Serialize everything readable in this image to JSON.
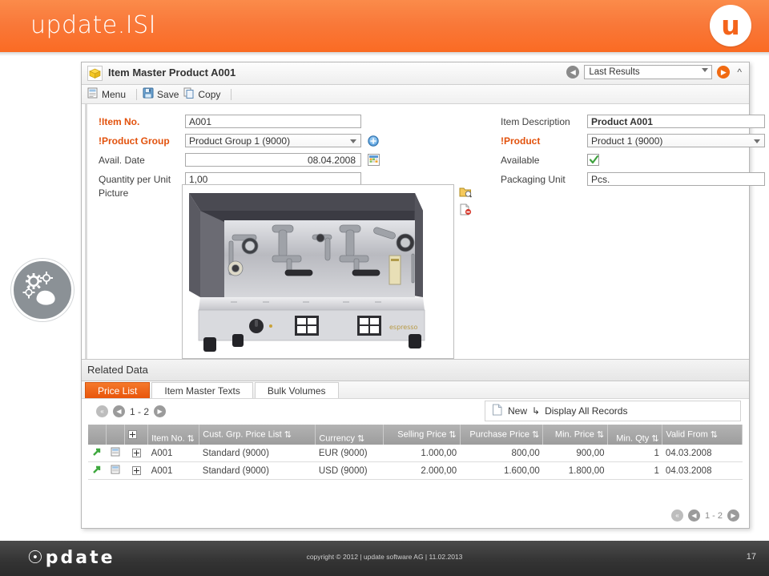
{
  "banner": {
    "title": "update.ISI",
    "logo_letter": "u",
    "logo_icon": "u-circle-logo"
  },
  "decor": {
    "gear_badge_icon": "gears-hand-icon"
  },
  "window": {
    "icon": "yellow-box-icon",
    "title": "Item Master Product A001",
    "results_select": "Last Results",
    "back_icon": "back-arrow-icon",
    "forward_icon": "forward-arrow-icon",
    "collapse_icon": "chevron-up-icon"
  },
  "toolbar": {
    "items": [
      {
        "label": "Menu",
        "icon": "menu-icon"
      },
      {
        "label": "Save",
        "icon": "floppy-disk-icon"
      },
      {
        "label": "Copy",
        "icon": "copy-pages-icon"
      }
    ]
  },
  "form": {
    "left": [
      {
        "label": "Item No.",
        "required": true,
        "type": "input",
        "value": "A001"
      },
      {
        "label": "Product Group",
        "required": true,
        "type": "select",
        "value": "Product Group 1 (9000)",
        "adjunct": "add-circle-icon"
      },
      {
        "label": "Avail. Date",
        "required": false,
        "type": "input-right",
        "value": "08.04.2008",
        "adjunct": "calendar-icon"
      },
      {
        "label": "Quantity per Unit",
        "required": false,
        "type": "input",
        "value": "1,00"
      }
    ],
    "right": [
      {
        "label": "Item Description",
        "required": false,
        "type": "input-bold",
        "value": "Product A001"
      },
      {
        "label": "Product",
        "required": true,
        "type": "select",
        "value": "Product 1 (9000)",
        "adjunct": "download-circle-icon"
      },
      {
        "label": "Available",
        "required": false,
        "type": "checkbox",
        "value": "checked"
      },
      {
        "label": "Packaging Unit",
        "required": false,
        "type": "input",
        "value": "Pcs."
      }
    ],
    "picture_label": "Picture",
    "picture_alt": "espresso-machine-photo",
    "picture_tools": [
      {
        "icon": "folder-search-icon"
      },
      {
        "icon": "document-delete-icon"
      }
    ]
  },
  "related": {
    "section_title": "Related Data",
    "tabs": [
      {
        "label": "Price List",
        "active": true
      },
      {
        "label": "Item Master Texts",
        "active": false
      },
      {
        "label": "Bulk Volumes",
        "active": false
      }
    ],
    "pager_top": {
      "first_icon": "first-page-icon",
      "prev_icon": "prev-page-icon",
      "range": "1 - 2",
      "next_icon": "next-page-icon"
    },
    "actions": {
      "new_label": "New",
      "new_icon": "new-document-icon",
      "display_all_label": "Display All Records",
      "display_all_icon": "arrow-branch-icon"
    },
    "grid": {
      "columns": [
        {
          "label": "",
          "key": "expand-all",
          "align": "center"
        },
        {
          "label": "Item No.",
          "key": "item_no",
          "align": "left"
        },
        {
          "label": "Cust. Grp. Price List",
          "key": "price_list",
          "align": "left"
        },
        {
          "label": "Currency",
          "key": "currency",
          "align": "left"
        },
        {
          "label": "Selling Price",
          "key": "selling_price",
          "align": "right"
        },
        {
          "label": "Purchase Price",
          "key": "purchase_price",
          "align": "right"
        },
        {
          "label": "Min. Price",
          "key": "min_price",
          "align": "right"
        },
        {
          "label": "Min. Qty",
          "key": "min_qty",
          "align": "right"
        },
        {
          "label": "Valid From",
          "key": "valid_from",
          "align": "left"
        }
      ],
      "rows": [
        {
          "item_no": "A001",
          "price_list": "Standard (9000)",
          "currency": "EUR (9000)",
          "selling_price": "1.000,00",
          "purchase_price": "800,00",
          "min_price": "900,00",
          "min_qty": "1",
          "valid_from": "04.03.2008"
        },
        {
          "item_no": "A001",
          "price_list": "Standard (9000)",
          "currency": "USD (9000)",
          "selling_price": "2.000,00",
          "purchase_price": "1.600,00",
          "min_price": "1.800,00",
          "min_qty": "1",
          "valid_from": "04.03.2008"
        }
      ],
      "row_icons": {
        "goto": "green-arrow-icon",
        "detail": "record-detail-icon",
        "expand": "plus-box-icon"
      }
    },
    "pager_bottom": {
      "first_icon": "first-page-icon",
      "prev_icon": "prev-page-icon",
      "range": "1 - 2",
      "next_icon": "next-page-icon"
    }
  },
  "footer": {
    "logo": "pdate",
    "copyright": "copyright © 2012 | update software AG | 11.02.2013",
    "page_number": "17"
  },
  "colors": {
    "banner_orange": "#fa6b23",
    "accent_orange": "#e8540a",
    "required_red": "#e2520d",
    "grid_header_grey": "#a6a6a6",
    "footer_dark": "#333333"
  }
}
